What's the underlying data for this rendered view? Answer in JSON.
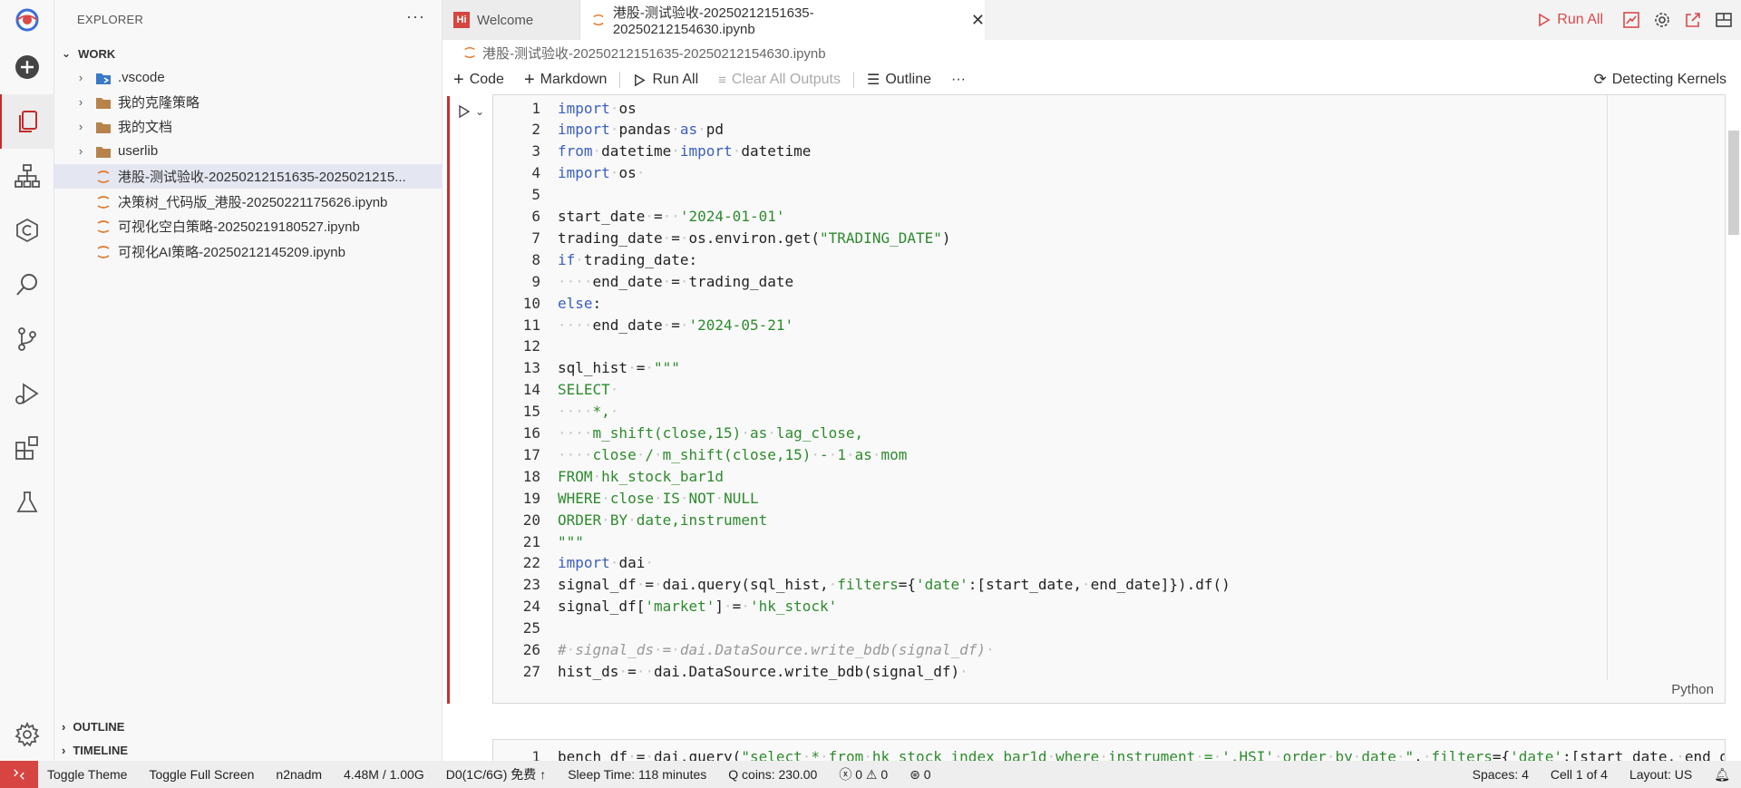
{
  "sidebar": {
    "title": "EXPLORER",
    "more": "···",
    "workspace": "WORK",
    "tree": [
      {
        "label": ".vscode",
        "type": "folder-vscode",
        "collapsed": true
      },
      {
        "label": "我的克隆策略",
        "type": "folder",
        "collapsed": true
      },
      {
        "label": "我的文档",
        "type": "folder",
        "collapsed": true
      },
      {
        "label": "userlib",
        "type": "folder",
        "collapsed": true
      },
      {
        "label": "港股-测试验收-20250212151635-2025021215...",
        "type": "notebook",
        "selected": true
      },
      {
        "label": "决策树_代码版_港股-20250221175626.ipynb",
        "type": "notebook"
      },
      {
        "label": "可视化空白策略-20250219180527.ipynb",
        "type": "notebook"
      },
      {
        "label": "可视化AI策略-20250212145209.ipynb",
        "type": "notebook"
      }
    ],
    "outline": "OUTLINE",
    "timeline": "TIMELINE"
  },
  "tabs": [
    {
      "label": "Welcome",
      "icon": "hi-icon",
      "active": false
    },
    {
      "label": "港股-测试验收-20250212151635-20250212154630.ipynb",
      "icon": "notebook-icon",
      "active": true,
      "close": "✕"
    }
  ],
  "tab_actions": {
    "run_all": "Run All"
  },
  "breadcrumb": "港股-测试验收-20250212151635-20250212154630.ipynb",
  "toolbar": {
    "code": "Code",
    "markdown": "Markdown",
    "run_all": "Run All",
    "clear_outputs": "Clear All Outputs",
    "outline": "Outline",
    "more": "···",
    "kernel": "Detecting Kernels"
  },
  "cell1": {
    "language": "Python",
    "lines": [
      {
        "n": "1",
        "html": "<span class='kw'>import</span><span class='ws'>·</span>os"
      },
      {
        "n": "2",
        "html": "<span class='kw'>import</span><span class='ws'>·</span>pandas<span class='ws'>·</span><span class='kw'>as</span><span class='ws'>·</span>pd"
      },
      {
        "n": "3",
        "html": "<span class='kw'>from</span><span class='ws'>·</span>datetime<span class='ws'>·</span><span class='kw'>import</span><span class='ws'>·</span>datetime"
      },
      {
        "n": "4",
        "html": "<span class='kw'>import</span><span class='ws'>·</span>os<span class='ws'>·</span>"
      },
      {
        "n": "5",
        "html": ""
      },
      {
        "n": "6",
        "html": "start_date<span class='ws'>·</span>=<span class='ws'>··</span><span class='str'>'2024-01-01'</span>"
      },
      {
        "n": "7",
        "html": "trading_date<span class='ws'>·</span>=<span class='ws'>·</span>os.environ.get(<span class='str'>\"TRADING_DATE\"</span>)"
      },
      {
        "n": "8",
        "html": "<span class='kw'>if</span><span class='ws'>·</span>trading_date:"
      },
      {
        "n": "9",
        "html": "<span class='ws'>····</span>end_date<span class='ws'>·</span>=<span class='ws'>·</span>trading_date"
      },
      {
        "n": "10",
        "html": "<span class='kw'>else</span>:"
      },
      {
        "n": "11",
        "html": "<span class='ws'>····</span>end_date<span class='ws'>·</span>=<span class='ws'>·</span><span class='str'>'2024-05-21'</span>"
      },
      {
        "n": "12",
        "html": ""
      },
      {
        "n": "13",
        "html": "sql_hist<span class='ws'>·</span>=<span class='ws'>·</span><span class='str'>\"\"\"</span>"
      },
      {
        "n": "14",
        "html": "<span class='str'>SELECT<span class='ws'>·</span></span>"
      },
      {
        "n": "15",
        "html": "<span class='ws'>····</span><span class='str'>*,<span class='ws'>·</span></span>"
      },
      {
        "n": "16",
        "html": "<span class='ws'>····</span><span class='str'>m_shift(close,15)<span class='ws'>·</span>as<span class='ws'>·</span>lag_close,</span>"
      },
      {
        "n": "17",
        "html": "<span class='ws'>····</span><span class='str'>close<span class='ws'>·</span>/<span class='ws'>·</span>m_shift(close,15)<span class='ws'>·</span>-<span class='ws'>·</span>1<span class='ws'>·</span>as<span class='ws'>·</span>mom</span>"
      },
      {
        "n": "18",
        "html": "<span class='str'>FROM<span class='ws'>·</span>hk_stock_bar1d</span>"
      },
      {
        "n": "19",
        "html": "<span class='str'>WHERE<span class='ws'>·</span>close<span class='ws'>·</span>IS<span class='ws'>·</span>NOT<span class='ws'>·</span>NULL</span>"
      },
      {
        "n": "20",
        "html": "<span class='str'>ORDER<span class='ws'>·</span>BY<span class='ws'>·</span>date,instrument</span>"
      },
      {
        "n": "21",
        "html": "<span class='str'>\"\"\"</span>"
      },
      {
        "n": "22",
        "html": "<span class='kw'>import</span><span class='ws'>·</span>dai<span class='ws'>·</span>"
      },
      {
        "n": "23",
        "html": "signal_df<span class='ws'>·</span>=<span class='ws'>·</span>dai.query(sql_hist,<span class='ws'>·</span><span class='str'>filters</span>={<span class='str'>'date'</span>:[start_date,<span class='ws'>·</span>end_date]}).df()"
      },
      {
        "n": "24",
        "html": "signal_df[<span class='str'>'market'</span>]<span class='ws'>·</span>=<span class='ws'>·</span><span class='str'>'hk_stock'</span>"
      },
      {
        "n": "25",
        "html": ""
      },
      {
        "n": "26",
        "html": "<span class='cmt'>#<span class='ws'>·</span>signal_ds<span class='ws'>·</span>=<span class='ws'>·</span>dai.DataSource.write_bdb(signal_df)<span class='ws'>·</span></span>"
      },
      {
        "n": "27",
        "html": "hist_ds<span class='ws'>·</span>=<span class='ws'>··</span>dai.DataSource.write_bdb(signal_df)<span class='ws'>·</span>"
      }
    ]
  },
  "cell2": {
    "n": "1",
    "html": "bench_df<span class='ws'>·</span>=<span class='ws'>·</span>dai.query(<span class='str'>\"select<span class='ws'>·</span>*<span class='ws'>·</span>from<span class='ws'>·</span>hk_stock_index_bar1d<span class='ws'>·</span>where<span class='ws'>·</span>instrument<span class='ws'>·</span>=<span class='ws'>·</span>'.HSI'<span class='ws'>·</span>order<span class='ws'>·</span>by<span class='ws'>·</span>date<span class='ws'>·</span>\"</span>,<span class='ws'>·</span><span class='str'>filters</span>={<span class='str'>'date'</span>:[start_date,<span class='ws'>·</span>end_d"
  },
  "statusbar": {
    "toggle_theme": "Toggle Theme",
    "toggle_fullscreen": "Toggle Full Screen",
    "user": "n2nadm",
    "memory": "4.48M / 1.00G",
    "resource": "D0(1C/6G) 免费 ↑",
    "sleep": "Sleep Time: 118 minutes",
    "coins": "Q coins: 230.00",
    "problems": "ⓧ 0 ⚠ 0",
    "ports": "0",
    "spaces": "Spaces: 4",
    "cell": "Cell 1 of 4",
    "layout": "Layout: US"
  }
}
